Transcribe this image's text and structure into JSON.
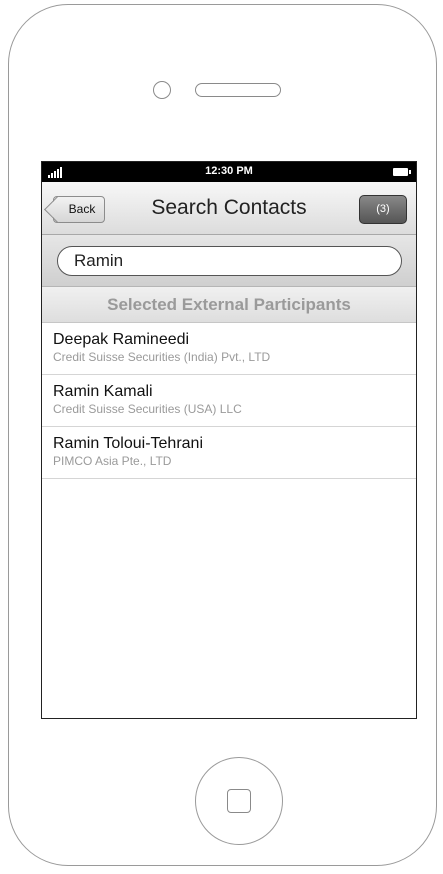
{
  "status_bar": {
    "time": "12:30 PM"
  },
  "nav": {
    "back_label": "Back",
    "title": "Search Contacts",
    "count_label": "(3)"
  },
  "search": {
    "value": "Ramin"
  },
  "section": {
    "title": "Selected External Participants"
  },
  "contacts": [
    {
      "name": "Deepak Ramineedi",
      "company": "Credit Suisse Securities (India) Pvt., LTD"
    },
    {
      "name": "Ramin Kamali",
      "company": "Credit Suisse Securities (USA) LLC"
    },
    {
      "name": "Ramin Toloui-Tehrani",
      "company": "PIMCO Asia Pte., LTD"
    }
  ],
  "icons": {
    "signal": "signal-strength-icon",
    "battery": "battery-icon",
    "camera": "camera-icon",
    "speaker": "speaker-icon",
    "home": "home-button-icon"
  }
}
